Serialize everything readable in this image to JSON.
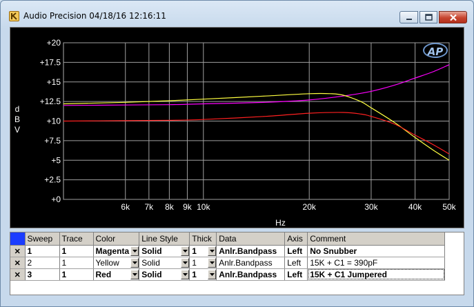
{
  "window": {
    "title": "Audio Precision  04/18/16 12:16:11",
    "accent": "#c7d9ec",
    "close_color": "#c7452f"
  },
  "icons": {
    "app": "audio-precision-app-icon",
    "minimize": "minimize-icon",
    "maximize": "maximize-icon",
    "close": "close-icon",
    "logo": "ap-logo"
  },
  "logo_text": "AP",
  "chart_data": {
    "type": "line",
    "ylabel": "dBV",
    "xlabel": "Hz",
    "x_scale": "log",
    "xlim": [
      4000,
      50000
    ],
    "ylim": [
      0,
      20
    ],
    "grid": true,
    "background": "#000000",
    "x_ticks": [
      {
        "value": 6000,
        "label": "6k"
      },
      {
        "value": 7000,
        "label": "7k"
      },
      {
        "value": 8000,
        "label": "8k"
      },
      {
        "value": 9000,
        "label": "9k"
      },
      {
        "value": 10000,
        "label": "10k"
      },
      {
        "value": 20000,
        "label": "20k"
      },
      {
        "value": 30000,
        "label": "30k"
      },
      {
        "value": 40000,
        "label": "40k"
      },
      {
        "value": 50000,
        "label": "50k"
      }
    ],
    "y_ticks": [
      {
        "value": 20,
        "label": "+20"
      },
      {
        "value": 17.5,
        "label": "+17.5"
      },
      {
        "value": 15,
        "label": "+15"
      },
      {
        "value": 12.5,
        "label": "+12.5"
      },
      {
        "value": 10,
        "label": "+10"
      },
      {
        "value": 7.5,
        "label": "+7.5"
      },
      {
        "value": 5,
        "label": "+5"
      },
      {
        "value": 2.5,
        "label": "+2.5"
      },
      {
        "value": 0,
        "label": "+0"
      }
    ],
    "series": [
      {
        "color": "#ff00ff",
        "x": [
          4000,
          6000,
          8000,
          10000,
          15000,
          20000,
          25000,
          30000,
          35000,
          40000,
          45000,
          50000
        ],
        "y": [
          12.0,
          12.05,
          12.1,
          12.2,
          12.4,
          12.7,
          13.2,
          13.8,
          14.6,
          15.5,
          16.3,
          17.2
        ]
      },
      {
        "color": "#ffff40",
        "x": [
          4000,
          6000,
          8000,
          10000,
          15000,
          20000,
          23000,
          25000,
          28000,
          30000,
          35000,
          40000,
          45000,
          50000
        ],
        "y": [
          12.2,
          12.4,
          12.6,
          12.8,
          13.2,
          13.5,
          13.5,
          13.3,
          12.5,
          11.7,
          9.8,
          7.9,
          6.3,
          5.0
        ]
      },
      {
        "color": "#ff2020",
        "x": [
          4000,
          6000,
          8000,
          10000,
          15000,
          20000,
          25000,
          28000,
          30000,
          35000,
          40000,
          45000,
          50000
        ],
        "y": [
          10.0,
          10.05,
          10.1,
          10.2,
          10.6,
          11.0,
          11.1,
          10.9,
          10.6,
          9.6,
          8.2,
          7.0,
          5.8
        ]
      }
    ]
  },
  "table": {
    "headers": [
      "Sweep",
      "Trace",
      "Color",
      "Line Style",
      "Thick",
      "Data",
      "Axis",
      "Comment"
    ],
    "rows": [
      {
        "sweep": "1",
        "trace": "1",
        "color": "Magenta",
        "line_style": "Solid",
        "thick": "1",
        "data": "Anlr.Bandpass",
        "axis": "Left",
        "comment": "No Snubber",
        "bold": true,
        "selected": false
      },
      {
        "sweep": "2",
        "trace": "1",
        "color": "Yellow",
        "line_style": "Solid",
        "thick": "1",
        "data": "Anlr.Bandpass",
        "axis": "Left",
        "comment": "15K + C1 = 390pF",
        "bold": false,
        "selected": false
      },
      {
        "sweep": "3",
        "trace": "1",
        "color": "Red",
        "line_style": "Solid",
        "thick": "1",
        "data": "Anlr.Bandpass",
        "axis": "Left",
        "comment": "15K + C1 Jumpered",
        "bold": true,
        "selected": true
      }
    ]
  }
}
